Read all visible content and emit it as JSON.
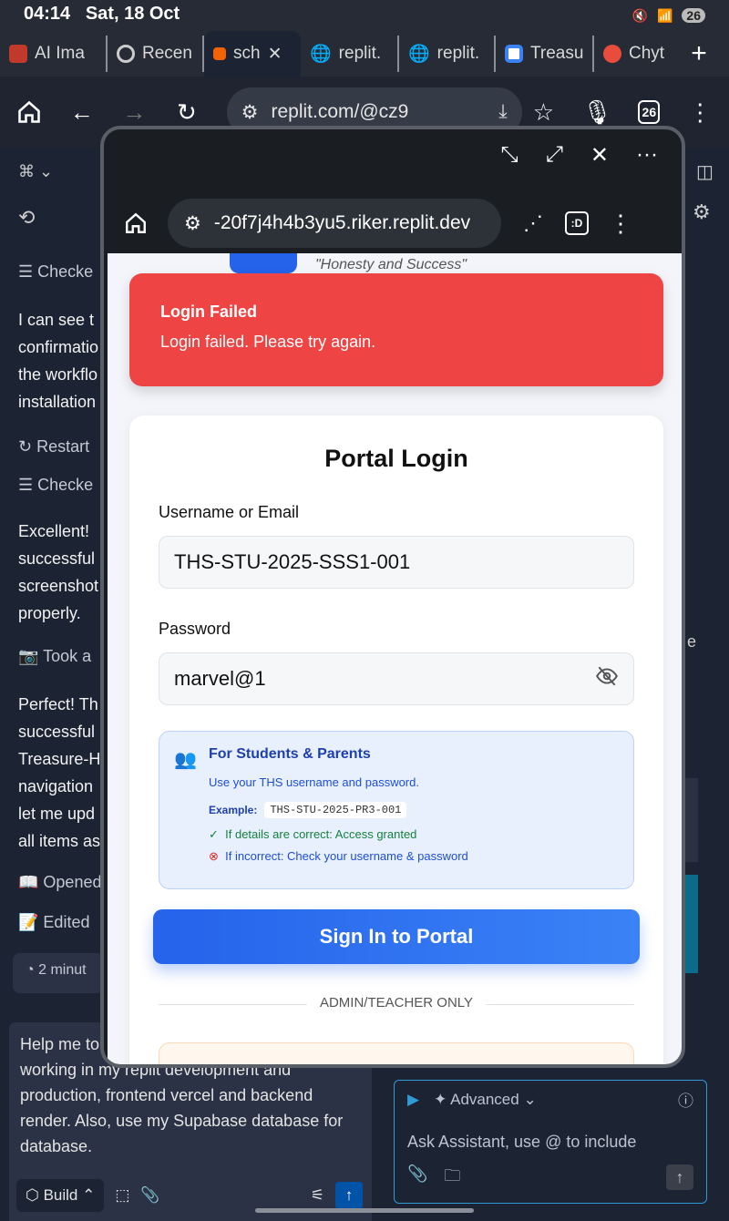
{
  "status_bar": {
    "time": "04:14",
    "date": "Sat, 18 Oct",
    "battery": "26"
  },
  "tabs": [
    {
      "label": "AI Ima",
      "color": "#c0392b"
    },
    {
      "label": "Recen",
      "color": "#888888"
    },
    {
      "label": "sch",
      "color": "#f26207"
    },
    {
      "label": "replit.",
      "color": "#888888"
    },
    {
      "label": "replit.",
      "color": "#888888"
    },
    {
      "label": "Treasu",
      "color": "#3b82f6"
    },
    {
      "label": "Chyt",
      "color": "#e74c3c"
    }
  ],
  "browser": {
    "url": "replit.com/@cz9",
    "tab_count": "26"
  },
  "background_app": {
    "items": [
      {
        "text": "Checke",
        "kind": "action"
      },
      {
        "text": "I can see t",
        "kind": "text"
      },
      {
        "text": "confirmatio",
        "kind": "text"
      },
      {
        "text": "the workflo",
        "kind": "text"
      },
      {
        "text": "installation",
        "kind": "text"
      },
      {
        "text": "Restart",
        "kind": "action"
      },
      {
        "text": "Checke",
        "kind": "action"
      },
      {
        "text": "Excellent!",
        "kind": "text"
      },
      {
        "text": "successful",
        "kind": "text"
      },
      {
        "text": "screenshot",
        "kind": "text"
      },
      {
        "text": "properly.",
        "kind": "text"
      },
      {
        "text": "Took a",
        "kind": "action"
      },
      {
        "text": "Perfect! Th",
        "kind": "text"
      },
      {
        "text": "successful",
        "kind": "text"
      },
      {
        "text": "Treasure-H",
        "kind": "text"
      },
      {
        "text": "navigation",
        "kind": "text"
      },
      {
        "text": "let me upd",
        "kind": "text"
      },
      {
        "text": "all items as",
        "kind": "text"
      },
      {
        "text": "Opened",
        "kind": "action"
      },
      {
        "text": "Edited",
        "kind": "action"
      }
    ],
    "time_chip": "2 minut",
    "chat_text": "Help me to ... into my website. Ensure it is working in my replit development and production, frontend vercel and backend render. Also, use my Supabase database for database.",
    "build_label": "Build",
    "assistant_mode": "Advanced",
    "assistant_placeholder": "Ask Assistant, use @ to include"
  },
  "popup": {
    "url": "-20f7j4h4b3yu5.riker.replit.dev",
    "motto": "\"Honesty and Success\"",
    "alert": {
      "title": "Login Failed",
      "message": "Login failed. Please try again."
    },
    "form": {
      "title": "Portal Login",
      "username_label": "Username or Email",
      "username_value": "THS-STU-2025-SSS1-001",
      "password_label": "Password",
      "password_value": "marvel@1"
    },
    "info": {
      "title": "For Students & Parents",
      "description": "Use your THS username and password.",
      "example_label": "Example:",
      "example_value": "THS-STU-2025-PR3-001",
      "correct": "If details are correct: Access granted",
      "incorrect": "If incorrect: Check your username & password"
    },
    "signin_button": "Sign In to Portal",
    "divider": "ADMIN/TEACHER ONLY"
  }
}
